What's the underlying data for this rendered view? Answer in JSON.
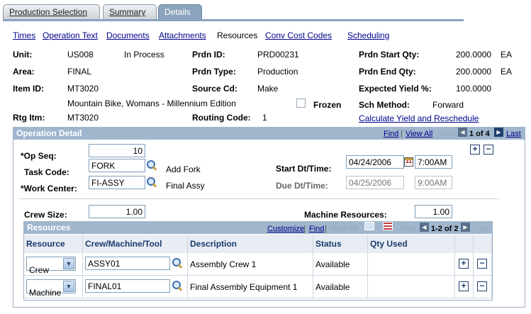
{
  "tabs": [
    "Production Selection",
    "Summary",
    "Details"
  ],
  "links": {
    "times": "Times",
    "operation_text": "Operation Text",
    "documents": "Documents",
    "attachments": "Attachments",
    "resources": "Resources",
    "conv_cost_codes": "Conv Cost Codes",
    "scheduling": "Scheduling"
  },
  "header": {
    "unit_label": "Unit:",
    "unit": "US008",
    "status": "In Process",
    "area_label": "Area:",
    "area": "FINAL",
    "item_label": "Item ID:",
    "item": "MT3020",
    "item_desc": "Mountain Bike, Womans - Millennium Edition",
    "rtg_label": "Rtg Itm:",
    "rtg": "MT3020",
    "prdn_id_label": "Prdn ID:",
    "prdn_id": "PRD00231",
    "prdn_type_label": "Prdn Type:",
    "prdn_type": "Production",
    "source_label": "Source Cd:",
    "source": "Make",
    "frozen_label": "Frozen",
    "routing_label": "Routing Code:",
    "routing": "1",
    "start_qty_label": "Prdn Start Qty:",
    "start_qty": "200.0000",
    "start_uom": "EA",
    "end_qty_label": "Prdn End Qty:",
    "end_qty": "200.0000",
    "end_uom": "EA",
    "yield_label": "Expected Yield %:",
    "yield": "100.0000",
    "sch_label": "Sch Method:",
    "sch": "Forward",
    "calc_link": "Calculate Yield and Reschedule"
  },
  "op_detail": {
    "title": "Operation Detail",
    "nav": {
      "find": "Find",
      "view_all": "View All",
      "first": "First",
      "count": "1 of 4",
      "last": "Last"
    },
    "op_seq_label": "*Op Seq:",
    "op_seq": "10",
    "task_label": "Task Code:",
    "task": "FORK",
    "task_desc": "Add Fork",
    "wc_label": "*Work Center:",
    "wc": "FI-ASSY",
    "wc_desc": "Final Assy",
    "start_label": "Start Dt/Time:",
    "start_date": "04/24/2006",
    "start_time": "7:00AM",
    "due_label": "Due Dt/Time:",
    "due_date": "04/25/2006",
    "due_time": "9:00AM",
    "crew_label": "Crew Size:",
    "crew": "1.00",
    "mach_label": "Machine Resources:",
    "mach": "1.00"
  },
  "resources": {
    "title": "Resources",
    "nav": {
      "customize": "Customize",
      "find": "Find",
      "view_all": "View All",
      "first": "First",
      "count": "1-2 of 2",
      "last": "Last"
    },
    "columns": [
      "Resource",
      "Crew/Machine/Tool",
      "Description",
      "Status",
      "Qty Used"
    ],
    "rows": [
      {
        "resource": "Crew",
        "tool": "ASSY01",
        "description": "Assembly Crew 1",
        "status": "Available"
      },
      {
        "resource": "Machine",
        "tool": "FINAL01",
        "description": "Final Assembly Equipment 1",
        "status": "Available"
      }
    ]
  },
  "colors": {
    "header_blue": "#9fb6cd",
    "link": "#00008b",
    "tab_active": "#8ba3bc"
  }
}
